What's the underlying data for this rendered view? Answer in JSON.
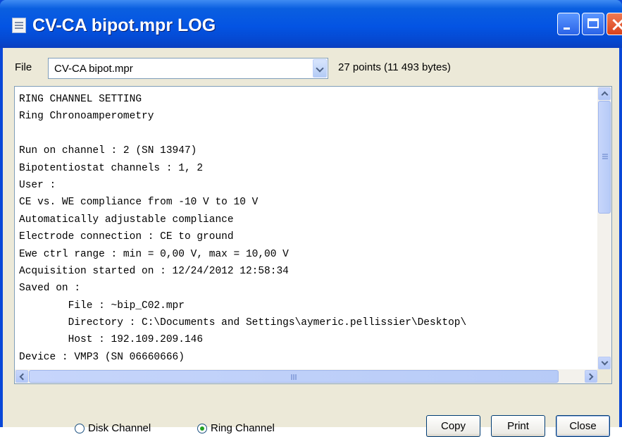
{
  "window": {
    "title": "CV-CA bipot.mpr LOG",
    "icon": "document-icon"
  },
  "file": {
    "label": "File",
    "selected": "CV-CA bipot.mpr",
    "info": "27 points (11 493 bytes)"
  },
  "log": {
    "lines": [
      "RING CHANNEL SETTING",
      "Ring Chronoamperometry",
      "",
      "Run on channel : 2 (SN 13947)",
      "Bipotentiostat channels : 1, 2",
      "User :",
      "CE vs. WE compliance from -10 V to 10 V",
      "Automatically adjustable compliance",
      "Electrode connection : CE to ground",
      "Ewe ctrl range : min = 0,00 V, max = 10,00 V",
      "Acquisition started on : 12/24/2012 12:58:34",
      "Saved on :",
      "        File : ~bip_C02.mpr",
      "        Directory : C:\\Documents and Settings\\aymeric.pellissier\\Desktop\\",
      "        Host : 192.109.209.146",
      "Device : VMP3 (SN 06660666)"
    ]
  },
  "channels": {
    "options": [
      "Disk Channel",
      "Ring Channel"
    ],
    "selected": "Ring Channel"
  },
  "buttons": {
    "copy": "Copy",
    "print": "Print",
    "close": "Close"
  },
  "colors": {
    "title_bar": "#0454e3",
    "dialog_bg": "#ece9d8",
    "close_button": "#d9421b",
    "radio_selected": "#21a121"
  }
}
